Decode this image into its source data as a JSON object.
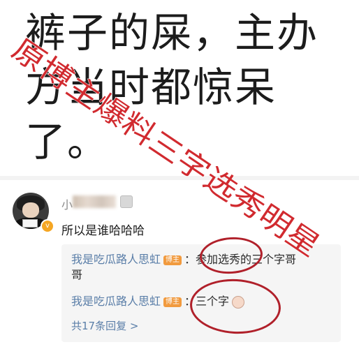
{
  "headline": {
    "lines": [
      "裤子的屎，主办",
      "方当时都惊呆",
      "了。"
    ]
  },
  "comment": {
    "username": "小",
    "text": "所以是谁哈哈哈",
    "replies": [
      {
        "author": "我是吃瓜路人思虹",
        "badge": "博主",
        "text": "：参加选秀的三个字哥",
        "continuation": "哥"
      },
      {
        "author": "我是吃瓜路人思虹",
        "badge": "博主",
        "text": "：三个字"
      }
    ],
    "more_replies": "共17条回复 >"
  },
  "watermark": {
    "text": "原博主爆料三字选秀明星",
    "color": "#d12a2f"
  },
  "annotation_color": "#b0202a"
}
